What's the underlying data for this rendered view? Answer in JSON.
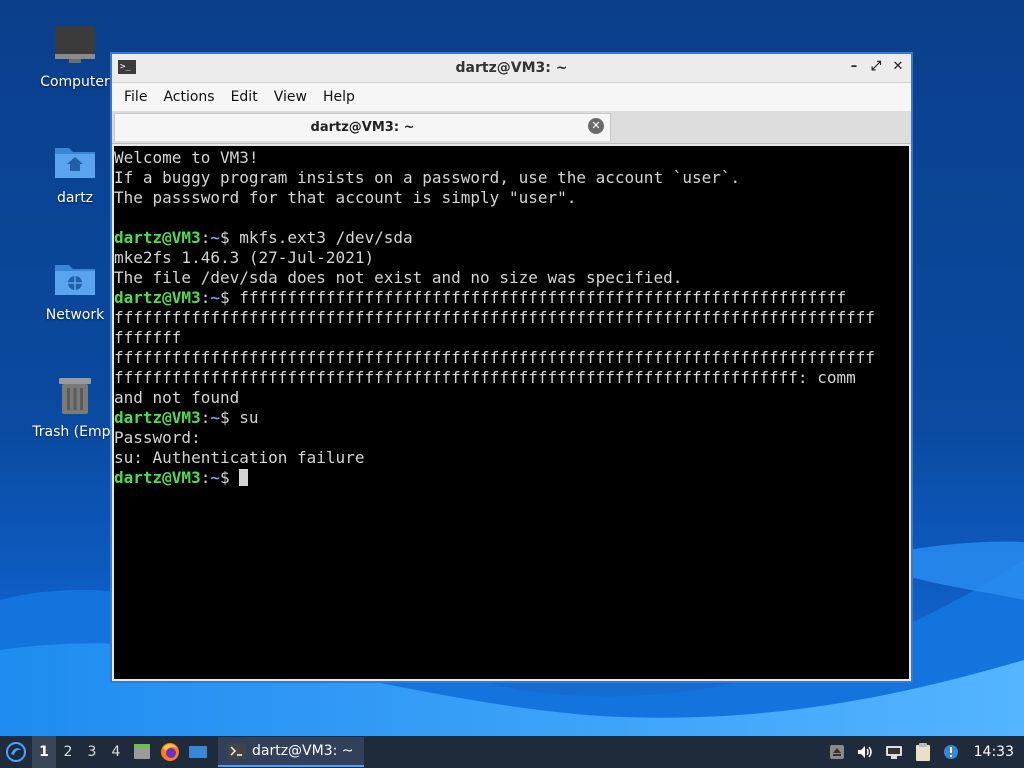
{
  "desktop": {
    "icons": [
      {
        "label": "Computer",
        "icon": "computer-icon"
      },
      {
        "label": "dartz",
        "icon": "home-folder-icon"
      },
      {
        "label": "Network",
        "icon": "network-folder-icon"
      },
      {
        "label": "Trash (Empty)",
        "icon": "trash-icon"
      }
    ]
  },
  "window": {
    "title": "dartz@VM3: ~",
    "controls": {
      "minimize": "–",
      "maximize": "⤢",
      "close": "✕"
    },
    "menu": [
      "File",
      "Actions",
      "Edit",
      "View",
      "Help"
    ],
    "tab": {
      "label": "dartz@VM3: ~",
      "close": "✕"
    }
  },
  "terminal": {
    "prompt_user": "dartz@VM3",
    "prompt_sep": ":",
    "prompt_path": "~",
    "prompt_char": "$ ",
    "lines": [
      {
        "type": "text",
        "text": "Welcome to VM3!"
      },
      {
        "type": "text",
        "text": "If a buggy program insists on a password, use the account `user`."
      },
      {
        "type": "text",
        "text": "The passsword for that account is simply \"user\"."
      },
      {
        "type": "text",
        "text": ""
      },
      {
        "type": "prompt",
        "cmd": "mkfs.ext3 /dev/sda"
      },
      {
        "type": "text",
        "text": "mke2fs 1.46.3 (27-Jul-2021)"
      },
      {
        "type": "text",
        "text": "The file /dev/sda does not exist and no size was specified."
      },
      {
        "type": "prompt",
        "cmd": "fffffffffffffffffffffffffffffffffffffffffffffffffffffffffffffff"
      },
      {
        "type": "text",
        "text": "fffffffffffffffffffffffffffffffffffffffffffffffffffffffffffffffffffffffffffffff"
      },
      {
        "type": "text",
        "text": "fffffff"
      },
      {
        "type": "text",
        "text": "fffffffffffffffffffffffffffffffffffffffffffffffffffffffffffffffffffffffffffffff"
      },
      {
        "type": "text",
        "text": "fffffffffffffffffffffffffffffffffffffffffffffffffffffffffffffffffffffff: comm"
      },
      {
        "type": "text",
        "text": "and not found"
      },
      {
        "type": "prompt",
        "cmd": "su"
      },
      {
        "type": "text",
        "text": "Password:"
      },
      {
        "type": "text",
        "text": "su: Authentication failure"
      },
      {
        "type": "prompt",
        "cmd": "",
        "cursor": true
      }
    ]
  },
  "taskbar": {
    "workspaces": [
      "1",
      "2",
      "3",
      "4"
    ],
    "active_workspace": "1",
    "launchers": [
      "start-menu-icon",
      "file-manager-icon",
      "firefox-icon",
      "show-desktop-icon"
    ],
    "task": {
      "label": "dartz@VM3: ~",
      "icon": "terminal-icon"
    },
    "tray": [
      "removable-drive-icon",
      "volume-icon",
      "network-icon",
      "clipboard-icon",
      "update-notifier-icon"
    ],
    "clock": "14:33"
  },
  "colors": {
    "prompt_user": "#4fdc4f",
    "prompt_path": "#6b9cf0",
    "window_border": "#3a78c9",
    "taskbar": "#1f2a3a"
  }
}
